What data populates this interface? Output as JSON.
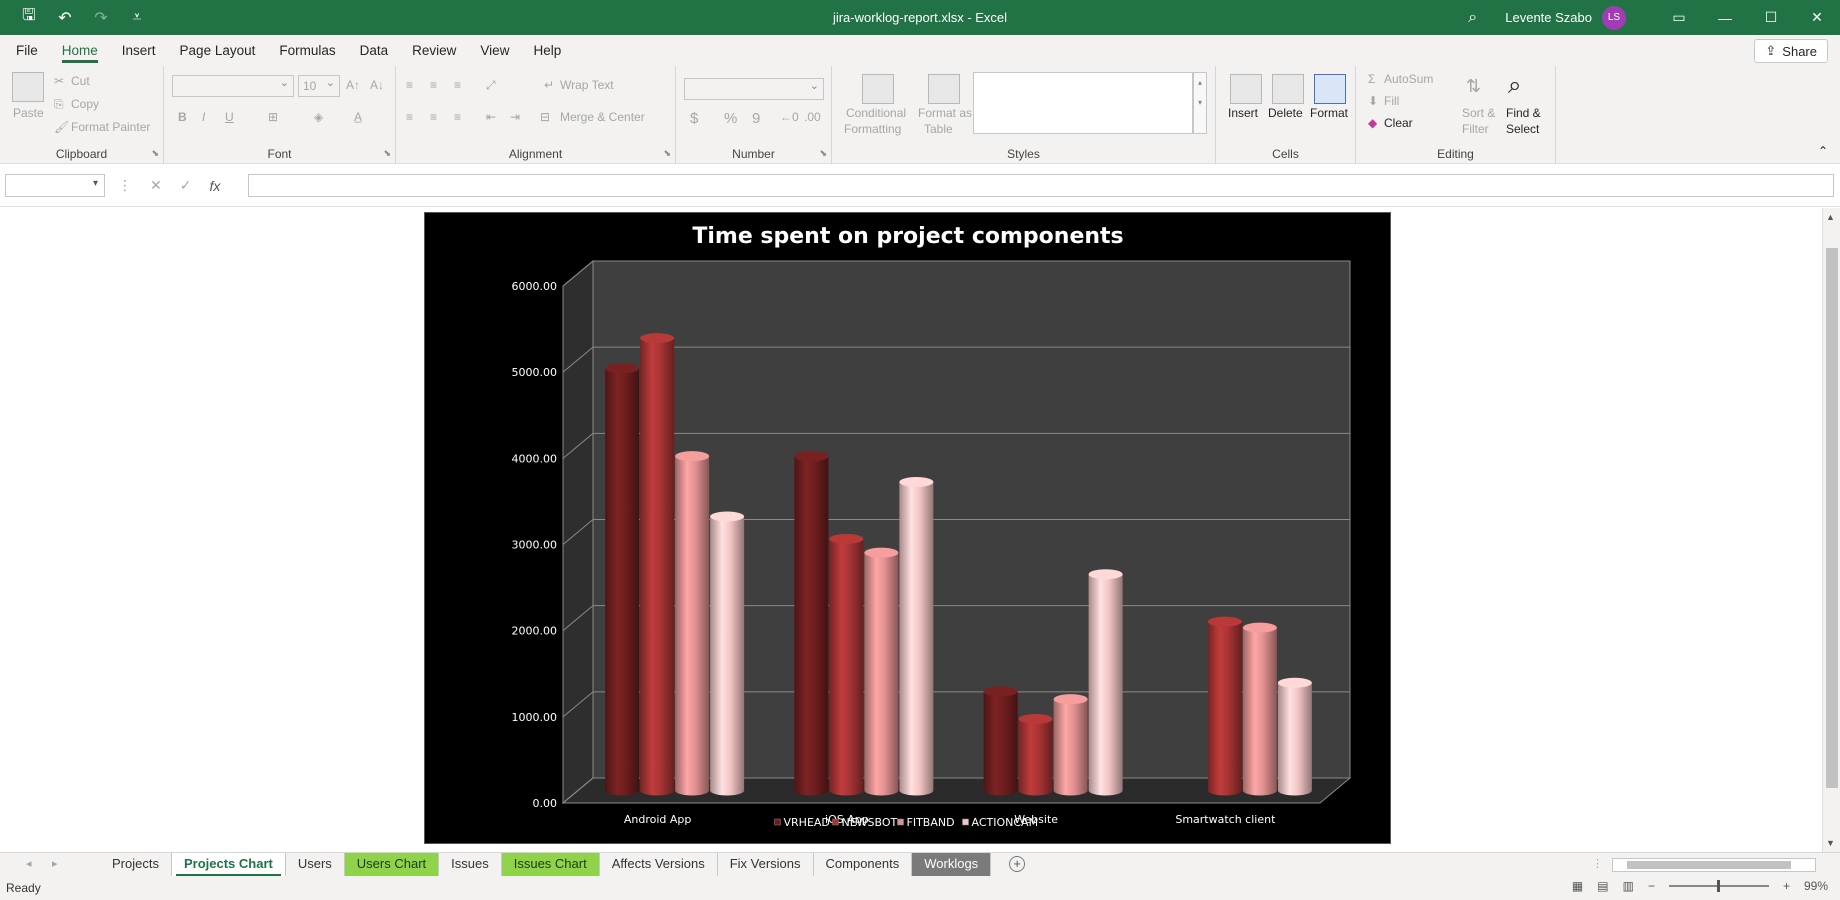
{
  "titlebar": {
    "title": "jira-worklog-report.xlsx  -  Excel",
    "user_name": "Levente Szabo",
    "user_initials": "LS",
    "icons": [
      "save-icon",
      "undo-icon",
      "redo-icon",
      "customize-qat-icon",
      "search-icon",
      "ribbon-display-icon",
      "minimize-icon",
      "maximize-icon",
      "close-icon"
    ]
  },
  "menu": {
    "tabs": [
      "File",
      "Home",
      "Insert",
      "Page Layout",
      "Formulas",
      "Data",
      "Review",
      "View",
      "Help"
    ],
    "active": "Home",
    "share_label": "Share"
  },
  "ribbon": {
    "clipboard": {
      "label": "Clipboard",
      "paste": "Paste",
      "cut": "Cut",
      "copy": "Copy",
      "format_painter": "Format Painter"
    },
    "font": {
      "label": "Font",
      "size": "10",
      "bold": "B",
      "italic": "I",
      "underline": "U"
    },
    "alignment": {
      "label": "Alignment",
      "wrap_text": "Wrap Text",
      "merge_center": "Merge & Center"
    },
    "number": {
      "label": "Number",
      "currency": "$",
      "percent": "%",
      "comma": "9"
    },
    "styles": {
      "label": "Styles",
      "conditional_1": "Conditional",
      "conditional_2": "Formatting",
      "format_as_1": "Format as",
      "format_as_2": "Table"
    },
    "cells": {
      "label": "Cells",
      "insert": "Insert",
      "delete": "Delete",
      "format": "Format"
    },
    "editing": {
      "label": "Editing",
      "autosum": "AutoSum",
      "fill": "Fill",
      "clear": "Clear",
      "sort_1": "Sort &",
      "sort_2": "Filter",
      "find_1": "Find &",
      "find_2": "Select"
    }
  },
  "formula_bar": {
    "name_box": "",
    "formula": ""
  },
  "chart_data": {
    "type": "bar",
    "title": "Time spent on project components",
    "categories": [
      "Android App",
      "iOS App",
      "Website",
      "Smartwatch client"
    ],
    "series": [
      {
        "name": "VRHEAD",
        "color": "#6e1e1e",
        "values": [
          4900,
          3880,
          1150,
          null
        ]
      },
      {
        "name": "NEWSBOT",
        "color": "#a83434",
        "values": [
          5250,
          2920,
          830,
          1960
        ]
      },
      {
        "name": "FITBAND",
        "color": "#e09090",
        "values": [
          3880,
          2760,
          1060,
          1890
        ]
      },
      {
        "name": "ACTIONCAM",
        "color": "#f2c4c4",
        "values": [
          3180,
          3580,
          2510,
          1250
        ]
      }
    ],
    "ylim": [
      0,
      6000
    ],
    "yticks": [
      "0.00",
      "1000.00",
      "2000.00",
      "3000.00",
      "4000.00",
      "5000.00",
      "6000.00"
    ],
    "grid": true,
    "legend_position": "bottom"
  },
  "sheets": {
    "tabs": [
      {
        "label": "Projects",
        "style": "plain"
      },
      {
        "label": "Projects Chart",
        "style": "active"
      },
      {
        "label": "Users",
        "style": "plain"
      },
      {
        "label": "Users Chart",
        "style": "green"
      },
      {
        "label": "Issues",
        "style": "plain"
      },
      {
        "label": "Issues Chart",
        "style": "green"
      },
      {
        "label": "Affects Versions",
        "style": "plain"
      },
      {
        "label": "Fix Versions",
        "style": "plain"
      },
      {
        "label": "Components",
        "style": "plain"
      },
      {
        "label": "Worklogs",
        "style": "gray"
      }
    ]
  },
  "status": {
    "ready": "Ready",
    "zoom": "99%"
  }
}
